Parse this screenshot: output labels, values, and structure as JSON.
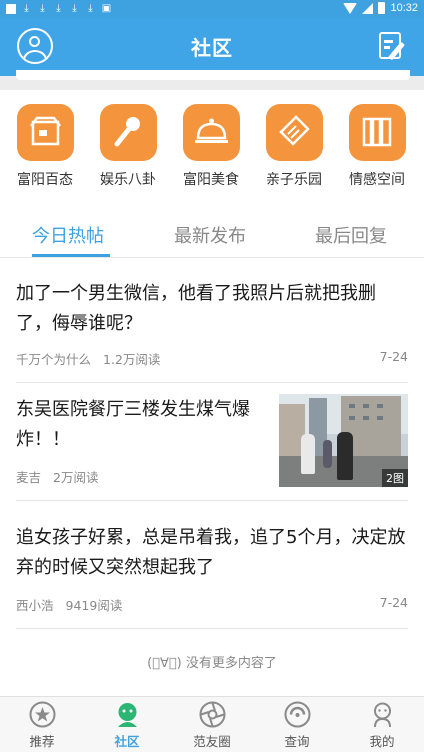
{
  "status_bar": {
    "time": "10:32",
    "left_icons": [
      "notification-icon",
      "download-icon",
      "download-icon",
      "download-icon",
      "download-icon",
      "download-icon",
      "image-icon"
    ]
  },
  "header": {
    "title": "社区"
  },
  "categories": [
    {
      "label": "富阳百态",
      "icon": "shop-icon"
    },
    {
      "label": "娱乐八卦",
      "icon": "microphone-icon"
    },
    {
      "label": "富阳美食",
      "icon": "food-cloche-icon"
    },
    {
      "label": "亲子乐园",
      "icon": "tag-icon"
    },
    {
      "label": "情感空间",
      "icon": "books-icon"
    }
  ],
  "tabs": [
    {
      "label": "今日热帖",
      "active": true
    },
    {
      "label": "最新发布",
      "active": false
    },
    {
      "label": "最后回复",
      "active": false
    }
  ],
  "posts": [
    {
      "title": "加了一个男生微信，他看了我照片后就把我删了，侮辱谁呢？",
      "author": "千万个为什么",
      "reads": "1.2万阅读",
      "date": "7-24"
    },
    {
      "title": "东吴医院餐厅三楼发生煤气爆炸！！",
      "author": "麦吉",
      "reads": "2万阅读",
      "image_count": "2图"
    },
    {
      "title": "追女孩子好累，总是吊着我，追了5个月，决定放弃的时候又突然想起我了",
      "author": "西小浩",
      "reads": "9419阅读",
      "date": "7-24"
    }
  ],
  "no_more_text": "(ﾟ∀ﾟ) 没有更多内容了",
  "bottom_nav": [
    {
      "label": "推荐",
      "icon": "star-icon",
      "active": false
    },
    {
      "label": "社区",
      "icon": "community-icon",
      "active": true
    },
    {
      "label": "范友圈",
      "icon": "camera-aperture-icon",
      "active": false
    },
    {
      "label": "查询",
      "icon": "search-dial-icon",
      "active": false
    },
    {
      "label": "我的",
      "icon": "person-icon",
      "active": false
    }
  ],
  "colors": {
    "primary": "#40a5e7",
    "category_orange": "#f4943d"
  }
}
